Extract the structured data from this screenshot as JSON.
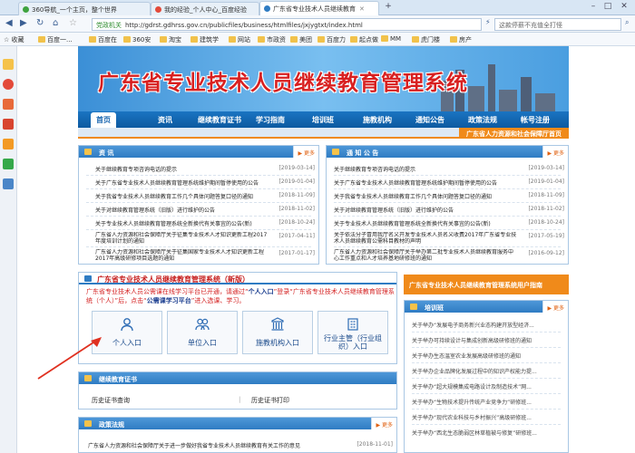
{
  "browser": {
    "tabs": [
      {
        "label": "360导航_一个主页，整个世界"
      },
      {
        "label": "我的经验_个人中心_百度经验"
      },
      {
        "label": "广东省专业技术人员继续教育"
      }
    ],
    "url_badge": "党政机关",
    "url": "http://gdrst.gdhrss.gov.cn/publicfiles/business/htmlfiles/jxjygtxt/index.html",
    "search_placeholder": "这款停薪不充值全打怪",
    "bookmarks": [
      "收藏",
      "百度一...",
      "百度在",
      "360安",
      "淘宝",
      "建筑学",
      "网站",
      "市政资",
      "美团",
      "百度力",
      "起点做",
      "MM",
      "虎门楼",
      "房产"
    ]
  },
  "page": {
    "banner_title": "广东省专业技术人员继续教育管理系统",
    "nav": [
      "首页",
      "资讯",
      "继续教育证书",
      "学习指南",
      "培训班",
      "施教机构",
      "通知公告",
      "政策法规",
      "帐号注册"
    ],
    "dept_link": "广东省人力资源和社会保障厅首页",
    "more": "更多",
    "news": {
      "title": "资 讯",
      "items": [
        {
          "text": "关于继续教育专项咨询电话的提示",
          "date": "[2019-03-14]"
        },
        {
          "text": "关于广东省专业技术人员继续教育管理系统维护期间暂停使用的公告",
          "date": "[2019-01-04]"
        },
        {
          "text": "关于我省专业技术人员继续教育工作几个具体问题答复口径的通知",
          "date": "[2018-11-09]"
        },
        {
          "text": "关于对继续教育管理系统（旧版）进行维护的公告",
          "date": "[2018-11-02]"
        },
        {
          "text": "关于专业技术人员继续教育管理系统全新换代有关事宜的公告(新)",
          "date": "[2018-10-24]"
        },
        {
          "text": "广东省人力资源和社会保障厅关于征集专业技术人才知识更新工程2017年度培训计划的通知",
          "date": "[2017-04-11]"
        },
        {
          "text": "广东省人力资源和社会保障厅关于征集国家专业技术人才知识更新工程2017年高级研修项目选题的通知",
          "date": "[2017-01-17]"
        }
      ]
    },
    "notices": {
      "title": "通 知 公 告",
      "items": [
        {
          "text": "关于继续教育专项咨询电话的提示",
          "date": "[2019-03-14]"
        },
        {
          "text": "关于广东省专业技术人员继续教育管理系统维护期间暂停使用的公告",
          "date": "[2019-01-04]"
        },
        {
          "text": "关于我省专业技术人员继续教育工作几个具体问题答复口径的通知",
          "date": "[2018-11-09]"
        },
        {
          "text": "关于对继续教育管理系统（旧版）进行维护的公告",
          "date": "[2018-11-02]"
        },
        {
          "text": "关于专业技术人员继续教育管理系统全新换代有关事宜的公告(新)",
          "date": "[2018-10-24]"
        },
        {
          "text": "关于依法分子冒用我厅名义开发专业技术人员名义收费2017年广东省专业技术人员继续教育公需科目教材的声明",
          "date": "[2017-05-19]"
        },
        {
          "text": "广东省人力资源和社会保障厅关于举办第二批专业技术人员继续教育服务中心工作重点和人才培养基地研修班的通知",
          "date": "[2016-09-12]"
        }
      ]
    },
    "newsys": {
      "title": "广东省专业技术人员继续教育管理系统（新版）",
      "notice_pre": "广东省专业技术人员公需课在线学习平台已开通，请通过“",
      "notice_b1": "个人入口",
      "notice_mid": "”登录“广东省专业技术人员继续教育管理系统（个人）”后，点击“",
      "notice_b2": "公需课学习平台",
      "notice_post": "”进入选课、学习。",
      "entries": [
        "个人入口",
        "单位入口",
        "施教机构入口",
        "行业主管（行业组织）入口"
      ]
    },
    "cert": {
      "title": "继续教育证书",
      "query": "历史证书查询",
      "print": "历史证书打印"
    },
    "policy": {
      "title": "政策法规",
      "items": [
        {
          "text": "广东省人力资源和社会保障厅关于进一步做好我省专业技术人员继续教育有关工作的意见",
          "date": "[2018-11-01]"
        }
      ]
    },
    "user_guide": "广东省专业技术人员继续教育管理系统用户指南",
    "training": {
      "title": "培训班",
      "items": [
        "关于举办“发展电子商务新兴业态构建开放型经济...",
        "关于举办可持续设计与集成创新高级研修班的通知",
        "关于举办生态温室农业发展高级研修班的通知",
        "关于举办企业品牌化发展过程中的知识产权能力提...",
        "关于举办“超大规模集成电路设计及制造技术”网...",
        "关于举办“生物技术提升传统产业竞争力”研修班...",
        "关于举办“现代农业科技与乡村振兴”高级研修班...",
        "关于举办“西北生态脆弱区林草植被与修复”研修班..."
      ]
    }
  },
  "colors": {
    "nav_blue": "#0d5aa0",
    "accent_orange": "#f08a1a",
    "title_red": "#d82020",
    "panel_header_blue": "#2f7cc3",
    "arrow_red": "#e03020"
  }
}
